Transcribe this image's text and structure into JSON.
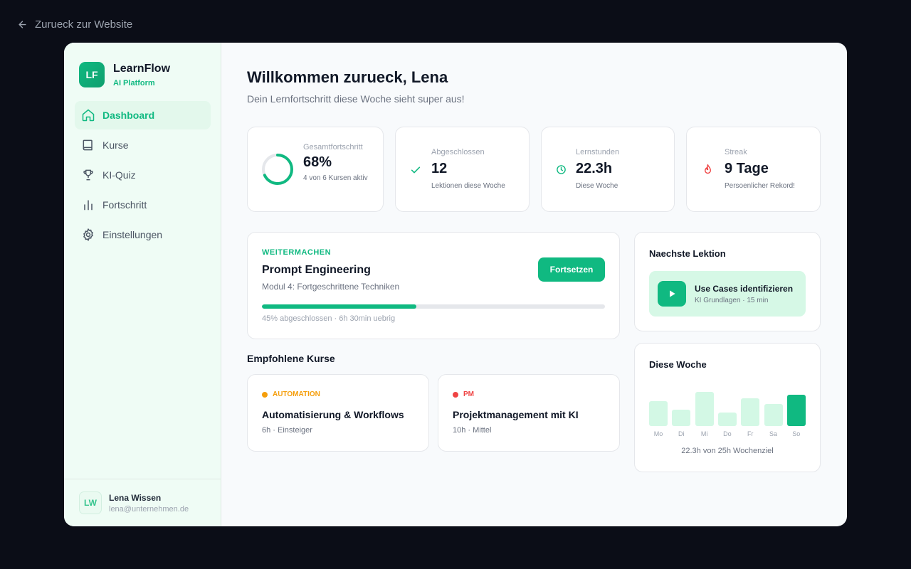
{
  "back_link": {
    "label": "Zurueck zur Website",
    "icon": "arrow-left-icon"
  },
  "brand": {
    "logo": "LF",
    "name": "LearnFlow",
    "tagline": "AI Platform"
  },
  "nav": {
    "items": [
      {
        "label": "Dashboard",
        "icon": "home-icon",
        "active": true
      },
      {
        "label": "Kurse",
        "icon": "book-icon"
      },
      {
        "label": "KI-Quiz",
        "icon": "trophy-icon"
      },
      {
        "label": "Fortschritt",
        "icon": "bar-chart-icon"
      },
      {
        "label": "Einstellungen",
        "icon": "gear-icon"
      }
    ]
  },
  "user": {
    "initials": "LW",
    "name": "Lena Wissen",
    "email": "lena@unternehmen.de"
  },
  "header": {
    "title": "Willkommen zurueck, Lena",
    "subtitle": "Dein Lernfortschritt diese Woche sieht super aus!"
  },
  "stats": {
    "overall": {
      "label": "Gesamtfortschritt",
      "value": "68%",
      "sub": "4 von 6 Kursen aktiv",
      "progress": 0.68
    },
    "completed": {
      "label": "Abgeschlossen",
      "value": "12",
      "sub": "Lektionen diese Woche",
      "icon": "check-icon"
    },
    "hours": {
      "label": "Lernstunden",
      "value": "22.3h",
      "sub": "Diese Woche",
      "icon": "clock-icon"
    },
    "streak": {
      "label": "Streak",
      "value": "9 Tage",
      "sub": "Persoenlicher Rekord!",
      "icon": "flame-icon"
    }
  },
  "continue": {
    "eyebrow": "WEITERMACHEN",
    "title": "Prompt Engineering",
    "module": "Modul 4: Fortgeschrittene Techniken",
    "button": "Fortsetzen",
    "progress": 0.45,
    "meta": "45% abgeschlossen · 6h 30min uebrig"
  },
  "recommended": {
    "title": "Empfohlene Kurse",
    "courses": [
      {
        "tag": "AUTOMATION",
        "tag_color": "#f59e0b",
        "title": "Automatisierung & Workflows",
        "meta": "6h · Einsteiger"
      },
      {
        "tag": "PM",
        "tag_color": "#ef4444",
        "title": "Projektmanagement mit KI",
        "meta": "10h · Mittel"
      }
    ]
  },
  "next_lesson": {
    "title": "Naechste Lektion",
    "lesson_title": "Use Cases identifizieren",
    "lesson_meta": "KI Grundlagen · 15 min",
    "icon": "play-icon"
  },
  "week": {
    "title": "Diese Woche",
    "days": [
      "Mo",
      "Di",
      "Mi",
      "Do",
      "Fr",
      "Sa",
      "So"
    ],
    "levels": [
      0.64,
      0.43,
      0.89,
      0.36,
      0.73,
      0.57,
      0.82
    ],
    "today_index": 6,
    "summary": "22.3h von 25h Wochenziel"
  },
  "colors": {
    "accent": "#10b981",
    "sidebar_bg": "#effcf5",
    "page_bg": "#0b0d17"
  }
}
